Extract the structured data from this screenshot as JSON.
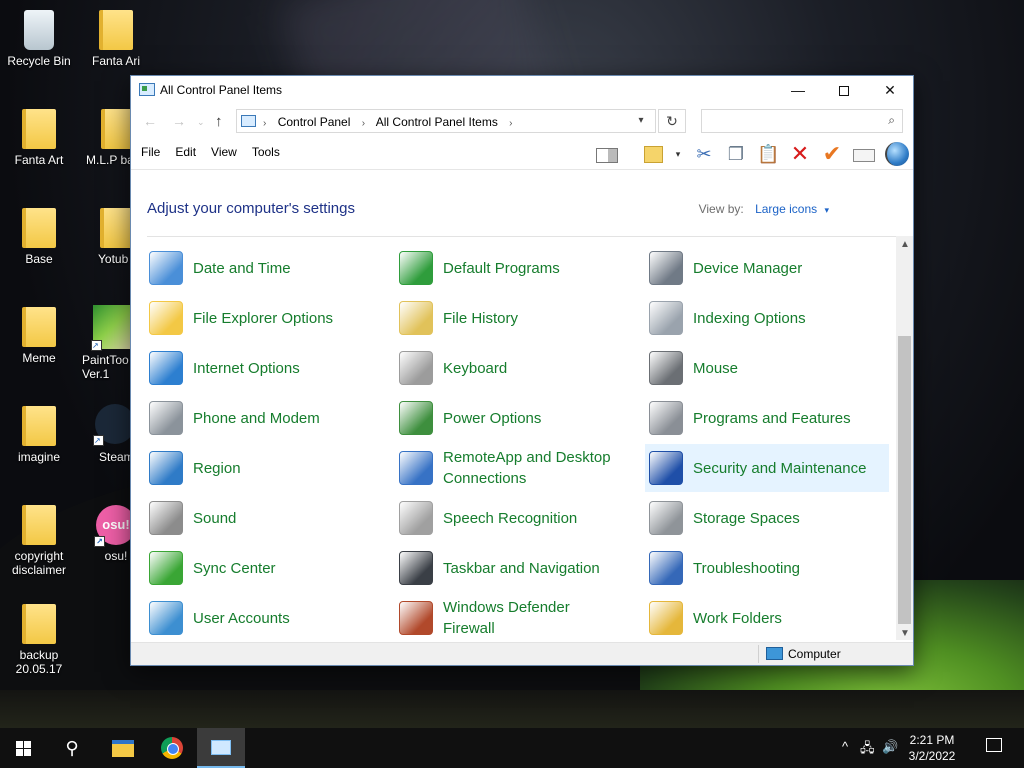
{
  "desktop": {
    "icons": [
      {
        "label": "Recycle Bin"
      },
      {
        "label": "Fanta Ari"
      },
      {
        "label": "Fanta Art"
      },
      {
        "label": "M.L.P ba"
      },
      {
        "label": "Base"
      },
      {
        "label": "Yotub"
      },
      {
        "label": "Meme"
      },
      {
        "label": "PaintToo Ver.1"
      },
      {
        "label": "imagine"
      },
      {
        "label": "Steam"
      },
      {
        "label": "copyright disclaimer"
      },
      {
        "label": "osu!"
      },
      {
        "label": "backup 20.05.17"
      }
    ],
    "osu_badge": "osu!"
  },
  "window": {
    "title": "All Control Panel Items",
    "controls": {
      "minimize": "—",
      "close": "✕"
    },
    "nav": {
      "back": "←",
      "forward": "→",
      "recent": "⌄",
      "up": "↑"
    },
    "breadcrumb": [
      "Control Panel",
      "All Control Panel Items"
    ],
    "breadcrumb_sep": "›",
    "refresh": "↻",
    "search": {
      "placeholder": "",
      "icon": "⌕"
    },
    "menu": [
      "File",
      "Edit",
      "View",
      "Tools"
    ],
    "toolbar_glyphs": {
      "dropdown": "▾",
      "cut": "✂",
      "copy": "❐",
      "paste": "📋",
      "delete": "✕",
      "check": "✔"
    },
    "heading": "Adjust your computer's settings",
    "view_by": {
      "label": "View by:",
      "value": "Large icons",
      "caret": "▾"
    },
    "status": "Computer",
    "scroll": {
      "up": "▲",
      "down": "▼"
    }
  },
  "items": [
    {
      "label": "Date and Time",
      "icon": "calendar-clock-icon",
      "color": "#4a8fd8"
    },
    {
      "label": "Default Programs",
      "icon": "default-programs-icon",
      "color": "#2f9d3c"
    },
    {
      "label": "Device Manager",
      "icon": "device-manager-icon",
      "color": "#707a86"
    },
    {
      "label": "File Explorer Options",
      "icon": "folder-options-icon",
      "color": "#f3c845"
    },
    {
      "label": "File History",
      "icon": "file-history-icon",
      "color": "#e1c25a"
    },
    {
      "label": "Indexing Options",
      "icon": "indexing-icon",
      "color": "#9aa3ad"
    },
    {
      "label": "Internet Options",
      "icon": "internet-globe-icon",
      "color": "#2d7fd0"
    },
    {
      "label": "Keyboard",
      "icon": "keyboard-icon",
      "color": "#9c9c9c"
    },
    {
      "label": "Mouse",
      "icon": "mouse-icon",
      "color": "#6b6f74"
    },
    {
      "label": "Phone and Modem",
      "icon": "phone-icon",
      "color": "#8b939b"
    },
    {
      "label": "Power Options",
      "icon": "power-icon",
      "color": "#3e8f3e"
    },
    {
      "label": "Programs and Features",
      "icon": "programs-icon",
      "color": "#8a8f96"
    },
    {
      "label": "Region",
      "icon": "region-globe-icon",
      "color": "#2f7bc7"
    },
    {
      "label": "RemoteApp and Desktop Connections",
      "icon": "remote-desktop-icon",
      "color": "#3772c5"
    },
    {
      "label": "Security and Maintenance",
      "icon": "security-flag-icon",
      "color": "#1f4fa8"
    },
    {
      "label": "Sound",
      "icon": "speaker-icon",
      "color": "#8c8c8c"
    },
    {
      "label": "Speech Recognition",
      "icon": "microphone-icon",
      "color": "#a0a0a0"
    },
    {
      "label": "Storage Spaces",
      "icon": "storage-icon",
      "color": "#8f9499"
    },
    {
      "label": "Sync Center",
      "icon": "sync-icon",
      "color": "#3aa635"
    },
    {
      "label": "Taskbar and Navigation",
      "icon": "taskbar-icon",
      "color": "#3a3f46"
    },
    {
      "label": "Troubleshooting",
      "icon": "troubleshoot-icon",
      "color": "#3568b8"
    },
    {
      "label": "User Accounts",
      "icon": "users-icon",
      "color": "#3d8fd1"
    },
    {
      "label": "Windows Defender Firewall",
      "icon": "firewall-icon",
      "color": "#b1492b"
    },
    {
      "label": "Work Folders",
      "icon": "work-folders-icon",
      "color": "#e5b73b"
    }
  ],
  "taskbar": {
    "search_glyph": "⚲",
    "tray_chevron": "^",
    "tray_network": "🖧",
    "tray_volume": "🔊",
    "clock_time": "2:21 PM",
    "clock_date": "3/2/2022"
  }
}
